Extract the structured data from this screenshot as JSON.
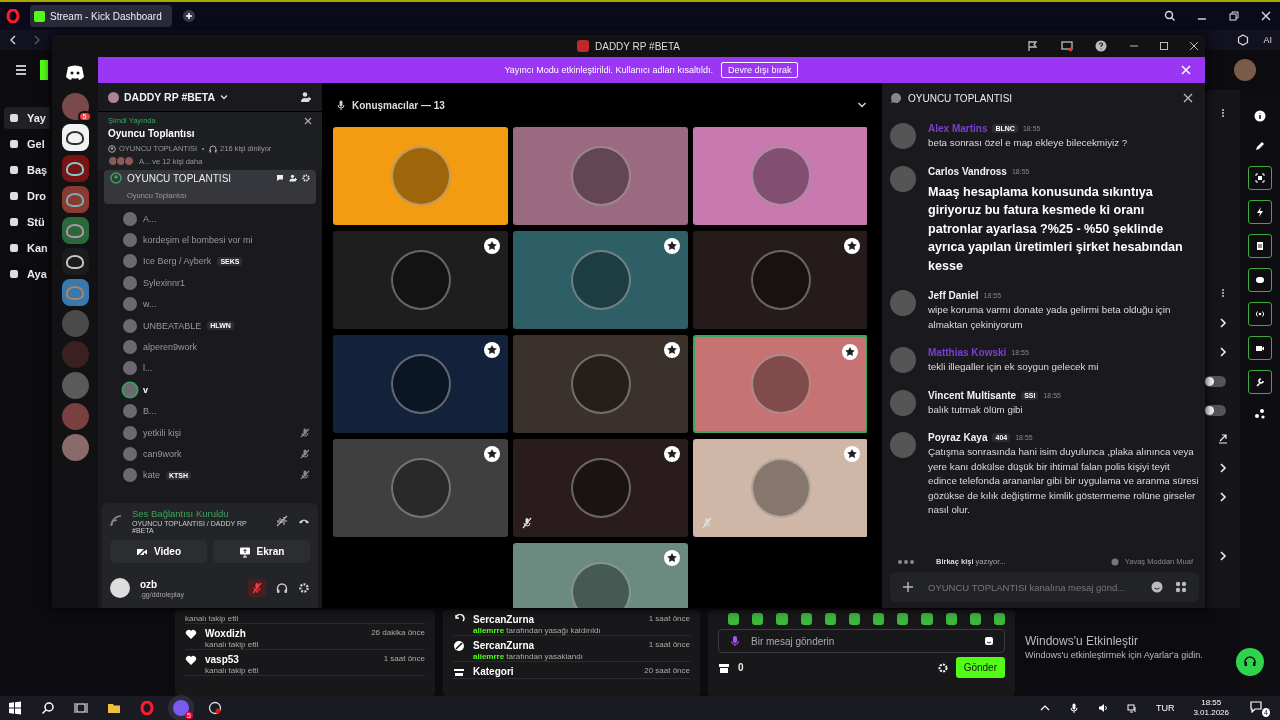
{
  "browser": {
    "tab_title": "Stream - Kick Dashboard",
    "assistant_label": "AI"
  },
  "kick": {
    "nav": [
      {
        "label": "Yay",
        "selected": true
      },
      {
        "label": "Gel",
        "selected": false
      },
      {
        "label": "Baş",
        "selected": false
      },
      {
        "label": "Dro",
        "selected": false
      },
      {
        "label": "Stü",
        "selected": false
      },
      {
        "label": "Kan",
        "selected": false
      },
      {
        "label": "Aya",
        "selected": false
      }
    ],
    "toggles": [
      {
        "on": false
      },
      {
        "on": false
      }
    ],
    "followers": [
      {
        "action": "kanalı takip etti"
      },
      {
        "name": "Woxdizh",
        "action": "kanalı takip etti",
        "time": "26 dakika önce"
      },
      {
        "name": "vasp53",
        "action": "kanalı takip etti",
        "time": "1 saat önce"
      }
    ],
    "mod_log": [
      {
        "kind": "unban",
        "target": "SercanZurna",
        "detail": "**aliemrre** tarafından yasağı kaldırıldı",
        "time": "1 saat önce"
      },
      {
        "kind": "ban",
        "target": "SercanZurna",
        "detail": "**aliemrre** tarafından yasaklandı",
        "time": "1 saat önce"
      },
      {
        "kind": "category",
        "target": "Kategori",
        "time": "20 saat önce"
      }
    ],
    "chat": {
      "placeholder": "Bir mesaj gönderin",
      "points": "0",
      "send": "Gönder"
    }
  },
  "activation": {
    "title": "Windows'u Etkinleştir",
    "subtitle": "Windows'u etkinleştirmek için Ayarlar'a gidin."
  },
  "discord": {
    "title": "DADDY RP #BETA",
    "banner": {
      "text": "Yayıncı Modu etkinleştirildi. Kullanıcı adları kısaltıldı.",
      "button": "Devre dışı bırak"
    },
    "servers": [
      {
        "kind": "avatar",
        "color": "#7a4a4a",
        "badge": "5"
      },
      {
        "kind": "logo",
        "color": "#f2f2f2"
      },
      {
        "kind": "logo",
        "color": "#7a1414"
      },
      {
        "kind": "logo",
        "color": "#8a3a30"
      },
      {
        "kind": "logo",
        "color": "#2a6a3a"
      },
      {
        "kind": "logo",
        "color": "#1c1c1c"
      },
      {
        "kind": "logo",
        "color": "#3a78b0"
      },
      {
        "kind": "avatar",
        "color": "#4a4a4a"
      },
      {
        "kind": "avatar",
        "color": "#3a2020"
      },
      {
        "kind": "avatar",
        "color": "#5a5a5a"
      },
      {
        "kind": "avatar",
        "color": "#7a4040"
      },
      {
        "kind": "avatar",
        "color": "#8a6a6a"
      }
    ],
    "server_name": "DADDY RP #BETA",
    "stage": {
      "status": "Şimdi Yayında",
      "title": "Oyuncu Toplantısı",
      "channel": "OYUNCU TOPLANTISI",
      "listeners": "216 kişi dinliyor",
      "others": "A... ve 12 kişi daha"
    },
    "channel": {
      "name": "OYUNCU TOPLANTISI",
      "topic": "Oyuncu Toplantısı",
      "selected": true
    },
    "members": [
      {
        "name": "A...",
        "muted": false,
        "speaking": false
      },
      {
        "name": "kordeşim el bombesi vor mi",
        "muted": false,
        "speaking": false
      },
      {
        "name": "Ice Berg / Ayberk",
        "tag": "SEKS",
        "muted": false,
        "speaking": false
      },
      {
        "name": "Sylexinnr1",
        "muted": false,
        "speaking": false
      },
      {
        "name": "w...",
        "muted": false,
        "speaking": false
      },
      {
        "name": "UNBEATABLE",
        "tag": "HLWN",
        "muted": false,
        "speaking": false
      },
      {
        "name": "alperen9work",
        "muted": false,
        "speaking": false
      },
      {
        "name": "l...",
        "muted": false,
        "speaking": false
      },
      {
        "name": "v",
        "muted": false,
        "speaking": true
      },
      {
        "name": "B...",
        "muted": false,
        "speaking": false
      },
      {
        "name": "yetkili kişi",
        "muted": true,
        "speaking": false
      },
      {
        "name": "can9work",
        "muted": true,
        "speaking": false
      },
      {
        "name": "kate",
        "tag": "KTSH",
        "muted": true,
        "speaking": false
      }
    ],
    "voice": {
      "status": "Ses Bağlantısı Kuruldu",
      "location": "OYUNCU TOPLANTISI / DADDY RP #BETA",
      "video": "Video",
      "screen": "Ekran"
    },
    "user": {
      "name": "ozb",
      "status": ".gg/ddroleplay",
      "muted": true
    },
    "speakers": {
      "title": "Konuşmacılar — 13",
      "tiles": [
        {
          "color": "#f39c12",
          "moderator": false,
          "muted": false,
          "speaking": false
        },
        {
          "color": "#9a6a80",
          "moderator": false,
          "muted": false,
          "speaking": false
        },
        {
          "color": "#c87ab0",
          "moderator": false,
          "muted": false,
          "speaking": false
        },
        {
          "color": "#1e1e1e",
          "moderator": true,
          "muted": false,
          "speaking": false
        },
        {
          "color": "#2f5f66",
          "moderator": true,
          "muted": false,
          "speaking": false
        },
        {
          "color": "#261b1b",
          "moderator": true,
          "muted": false,
          "speaking": false
        },
        {
          "color": "#12223a",
          "moderator": true,
          "muted": false,
          "speaking": false
        },
        {
          "color": "#3a302c",
          "moderator": true,
          "muted": false,
          "speaking": false
        },
        {
          "color": "#c77373",
          "moderator": true,
          "muted": false,
          "speaking": true
        },
        {
          "color": "#3f3f3f",
          "moderator": true,
          "muted": false,
          "speaking": false
        },
        {
          "color": "#2a1c1c",
          "moderator": true,
          "muted": true,
          "speaking": false
        },
        {
          "color": "#cfb6a6",
          "moderator": true,
          "muted": true,
          "speaking": false
        },
        {
          "color": "#6b8a80",
          "moderator": true,
          "muted": false,
          "speaking": false
        }
      ]
    },
    "chat": {
      "title": "OYUNCU TOPLANTISI",
      "messages": [
        {
          "author": "Alex Martins",
          "color": "#7b3fd0",
          "tag": "BLNC",
          "time": "18:55",
          "kind": "text",
          "text": "beta sonrası özel e map ekleye bilecekmiyiz ?"
        },
        {
          "author": "Carlos Vandross",
          "color": "#f2f3f5",
          "time": "18:55",
          "kind": "heading",
          "text": "Maaş hesaplama konusunda sıkıntıya giriyoruz bu fatura kesmede ki oranı patronlar ayarlasa ?%25 - %50 şeklinde ayrıca yapılan üretimleri şirket hesabından kesse"
        },
        {
          "author": "Jeff Daniel",
          "color": "#f2f3f5",
          "time": "18:55",
          "kind": "text",
          "text": "wipe koruma varmı donate yada gelirmi beta olduğu için almaktan çekiniyorum"
        },
        {
          "author": "Matthias Kowski",
          "color": "#7b3fd0",
          "time": "18:55",
          "kind": "text",
          "text": "tekli illegaller için ek soygun gelecek mi"
        },
        {
          "author": "Vincent Multisante",
          "color": "#f2f3f5",
          "tag": "SSI",
          "time": "18:55",
          "kind": "text",
          "text": "balık tutmak ölüm gibi"
        },
        {
          "author": "Poyraz Kaya",
          "color": "#f2f3f5",
          "tag": "404",
          "time": "18:55",
          "kind": "text",
          "text": "Çatışma sonrasında hani isim duyulunca ,plaka alınınca veya yere kanı dökülse düşük bir ihtimal falan polis kişiyi teyit edince telefonda arananlar gibi bir uygulama ve aranma süresi gözükse de kılık değiştirme kimlik göstermeme rolüne girseler nasıl olur."
        }
      ],
      "typing": "**Birkaç kişi** yazıyor...",
      "slowmode": "Yavaş Moddan Muaf",
      "placeholder": "OYUNCU TOPLANTISI kanalına mesaj gönd..."
    }
  },
  "taskbar": {
    "discord_badge": "5",
    "language": "TUR",
    "time": "18:55",
    "date": "3.01.2026",
    "notifications": "4"
  }
}
